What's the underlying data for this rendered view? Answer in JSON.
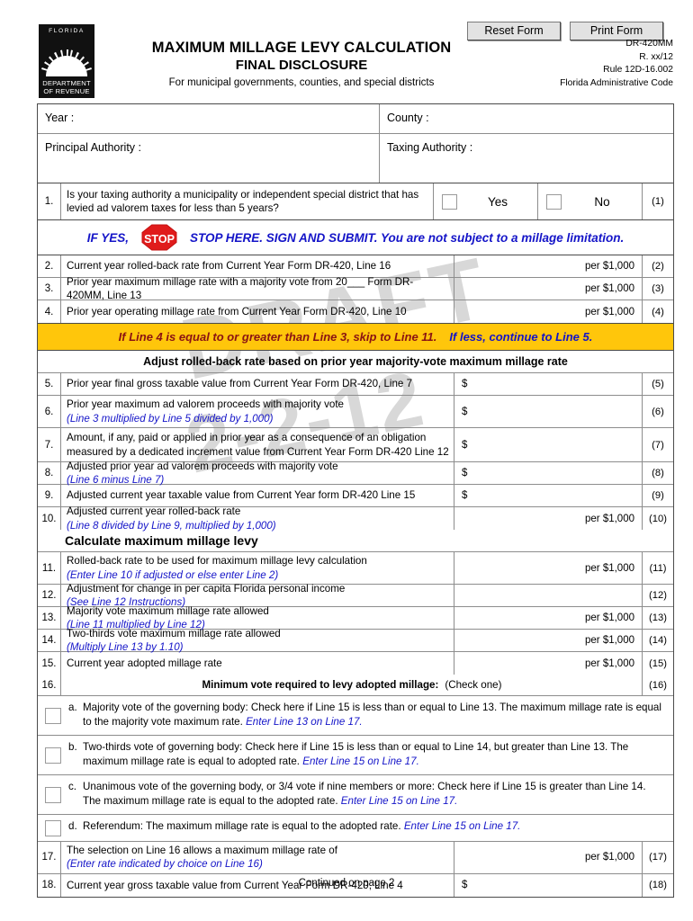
{
  "window": {
    "reset_button": "Reset Form",
    "print_button": "Print Form"
  },
  "logo": {
    "top_text": "FLORIDA",
    "bottom_line1": "DEPARTMENT",
    "bottom_line2": "OF REVENUE"
  },
  "header": {
    "title": "MAXIMUM MILLAGE LEVY CALCULATION",
    "subtitle": "FINAL DISCLOSURE",
    "description": "For municipal governments, counties, and special districts",
    "form_number": "DR-420MM",
    "revision": "R. xx/12",
    "rule": "Rule 12D-16.002",
    "code": "Florida Administrative Code"
  },
  "watermark": {
    "word": "DRAFT",
    "date": "2-2-12"
  },
  "identity": {
    "year_label": "Year :",
    "county_label": "County :",
    "principal_authority_label": "Principal Authority :",
    "taxing_authority_label": "Taxing Authority :",
    "year_value": "",
    "county_value": "",
    "principal_authority_value": "",
    "taxing_authority_value": ""
  },
  "question1": {
    "number": "1.",
    "text": "Is your taxing authority a municipality or independent special district that has levied ad valorem taxes for less than 5 years?",
    "yes_label": "Yes",
    "no_label": "No",
    "ref": "(1)"
  },
  "stop_banner": {
    "if_yes": "IF YES,",
    "sign_text": "STOP",
    "message": "STOP HERE.  SIGN AND SUBMIT. You are not subject to a millage limitation."
  },
  "yellow_banner": {
    "part1": "If Line 4 is equal to or greater than Line 3, skip to Line 11.",
    "part2": "If less, continue to Line 5."
  },
  "section_headings": {
    "adjust": "Adjust rolled-back rate based on prior year majority-vote maximum millage rate",
    "calculate": "Calculate maximum millage levy"
  },
  "lines": [
    {
      "number": "2.",
      "text": "Current year rolled-back rate from Current Year Form DR-420, Line 16",
      "note": "",
      "value_prefix": "",
      "value": "",
      "unit": "per $1,000",
      "unit_align": "right",
      "ref": "(2)"
    },
    {
      "number": "3.",
      "text": "Prior year maximum millage rate with a majority vote from 20___ Form DR-420MM, Line 13",
      "note": "",
      "value_prefix": "",
      "value": "",
      "unit": "per $1,000",
      "unit_align": "right",
      "ref": "(3)"
    },
    {
      "number": "4.",
      "text": "Prior year operating millage rate from Current Year Form DR-420, Line 10",
      "note": "",
      "value_prefix": "",
      "value": "",
      "unit": "per $1,000",
      "unit_align": "right",
      "ref": "(4)"
    },
    {
      "number": "5.",
      "text": "Prior year final gross taxable value from Current Year Form DR-420, Line 7",
      "note": "",
      "value_prefix": "$",
      "value": "",
      "unit": "",
      "unit_align": "left",
      "ref": "(5)"
    },
    {
      "number": "6.",
      "text": "Prior year maximum ad valorem proceeds with majority vote",
      "note": "(Line 3 multiplied by Line 5 divided by 1,000)",
      "value_prefix": "$",
      "value": "",
      "unit": "",
      "unit_align": "left",
      "ref": "(6)"
    },
    {
      "number": "7.",
      "text": "Amount, if any, paid or applied in prior year as a consequence of an obligation measured by a dedicated increment value from Current Year  Form DR-420 Line 12",
      "note": "",
      "value_prefix": "$",
      "value": "",
      "unit": "",
      "unit_align": "left",
      "ref": "(7)"
    },
    {
      "number": "8.",
      "text": "Adjusted prior year ad valorem proceeds with majority vote",
      "note_inline": "(Line 6 minus Line 7)",
      "note": "",
      "value_prefix": "$",
      "value": "",
      "unit": "",
      "unit_align": "left",
      "ref": "(8)"
    },
    {
      "number": "9.",
      "text": "Adjusted current year taxable value  from Current Year form DR-420 Line 15",
      "note": "",
      "value_prefix": "$",
      "value": "",
      "unit": "",
      "unit_align": "left",
      "ref": "(9)"
    },
    {
      "number": "10.",
      "text": "Adjusted current year rolled-back rate",
      "note_inline": "(Line 8 divided by Line 9, multiplied by 1,000)",
      "note": "",
      "value_prefix": "",
      "value": "",
      "unit": "per $1,000",
      "unit_align": "right",
      "ref": "(10)"
    },
    {
      "number": "11.",
      "text": "Rolled-back rate to be used for maximum millage levy calculation",
      "note": "(Enter Line 10 if adjusted or else enter Line 2)",
      "value_prefix": "",
      "value": "",
      "unit": "per $1,000",
      "unit_align": "right",
      "ref": "(11)"
    },
    {
      "number": "12.",
      "text": "Adjustment for change in per capita Florida personal income",
      "note_inline": "(See Line 12  Instructions)",
      "note": "",
      "value_prefix": "",
      "value": "",
      "unit": "",
      "unit_align": "right",
      "ref": "(12)"
    },
    {
      "number": "13.",
      "text": "Majority vote maximum millage rate allowed",
      "note_inline": "(Line 11 multiplied by Line 12)",
      "note": "",
      "value_prefix": "",
      "value": "",
      "unit": "per $1,000",
      "unit_align": "right",
      "ref": "(13)"
    },
    {
      "number": "14.",
      "text": "Two-thirds vote maximum millage rate allowed",
      "note_inline": "(Multiply Line 13 by 1.10)",
      "note": "",
      "value_prefix": "",
      "value": "",
      "unit": "per $1,000",
      "unit_align": "right",
      "ref": "(14)"
    },
    {
      "number": "15.",
      "text": "Current year adopted millage rate",
      "note": "",
      "value_prefix": "",
      "value": "",
      "unit": "per $1,000",
      "unit_align": "right",
      "ref": "(15)"
    }
  ],
  "line16": {
    "number": "16.",
    "text": "Minimum vote required to levy adopted millage:",
    "check_one": "(Check one)",
    "ref": "(16)",
    "options": [
      {
        "letter": "a.",
        "text": "Majority vote of the governing body:  Check here if Line 15  is less than or equal to Line 13. The maximum millage rate is equal to the majority vote maximum rate. ",
        "emphasis": "Enter Line 13 on Line 17."
      },
      {
        "letter": "b.",
        "text": "Two-thirds vote of governing body:  Check here if Line 15 is less than or equal to Line 14, but greater than Line 13. The maximum millage rate is equal to adopted rate. ",
        "emphasis": "Enter Line 15 on Line 17."
      },
      {
        "letter": "c.",
        "text": "Unanimous vote of the governing body, or 3/4 vote if nine members or more:  Check here if Line 15 is greater than Line 14. The maximum millage rate is equal to the adopted rate. ",
        "emphasis": "Enter Line 15 on Line 17."
      },
      {
        "letter": "d.",
        "text": "Referendum:  The maximum millage rate is equal to the adopted rate. ",
        "emphasis": "Enter Line 15 on Line 17."
      }
    ]
  },
  "lines_tail": [
    {
      "number": "17.",
      "text": "The selection on Line 16 allows a maximum millage rate of",
      "note": "(Enter rate indicated by choice on Line 16)",
      "value_prefix": "",
      "value": "",
      "unit": "per $1,000",
      "unit_align": "right",
      "ref": "(17)"
    },
    {
      "number": "18.",
      "text": "Current year gross taxable value from Current Year Form DR-420, Line 4",
      "note": "",
      "value_prefix": "$",
      "value": "",
      "unit": "",
      "unit_align": "left",
      "ref": "(18)"
    }
  ],
  "footer": {
    "text": "Continued on page 2"
  },
  "colors": {
    "banner_yellow": "#FFC60B",
    "banner_red_text": "#8A1313",
    "accent_blue": "#1414C8",
    "stop_red": "#E01B1B"
  }
}
